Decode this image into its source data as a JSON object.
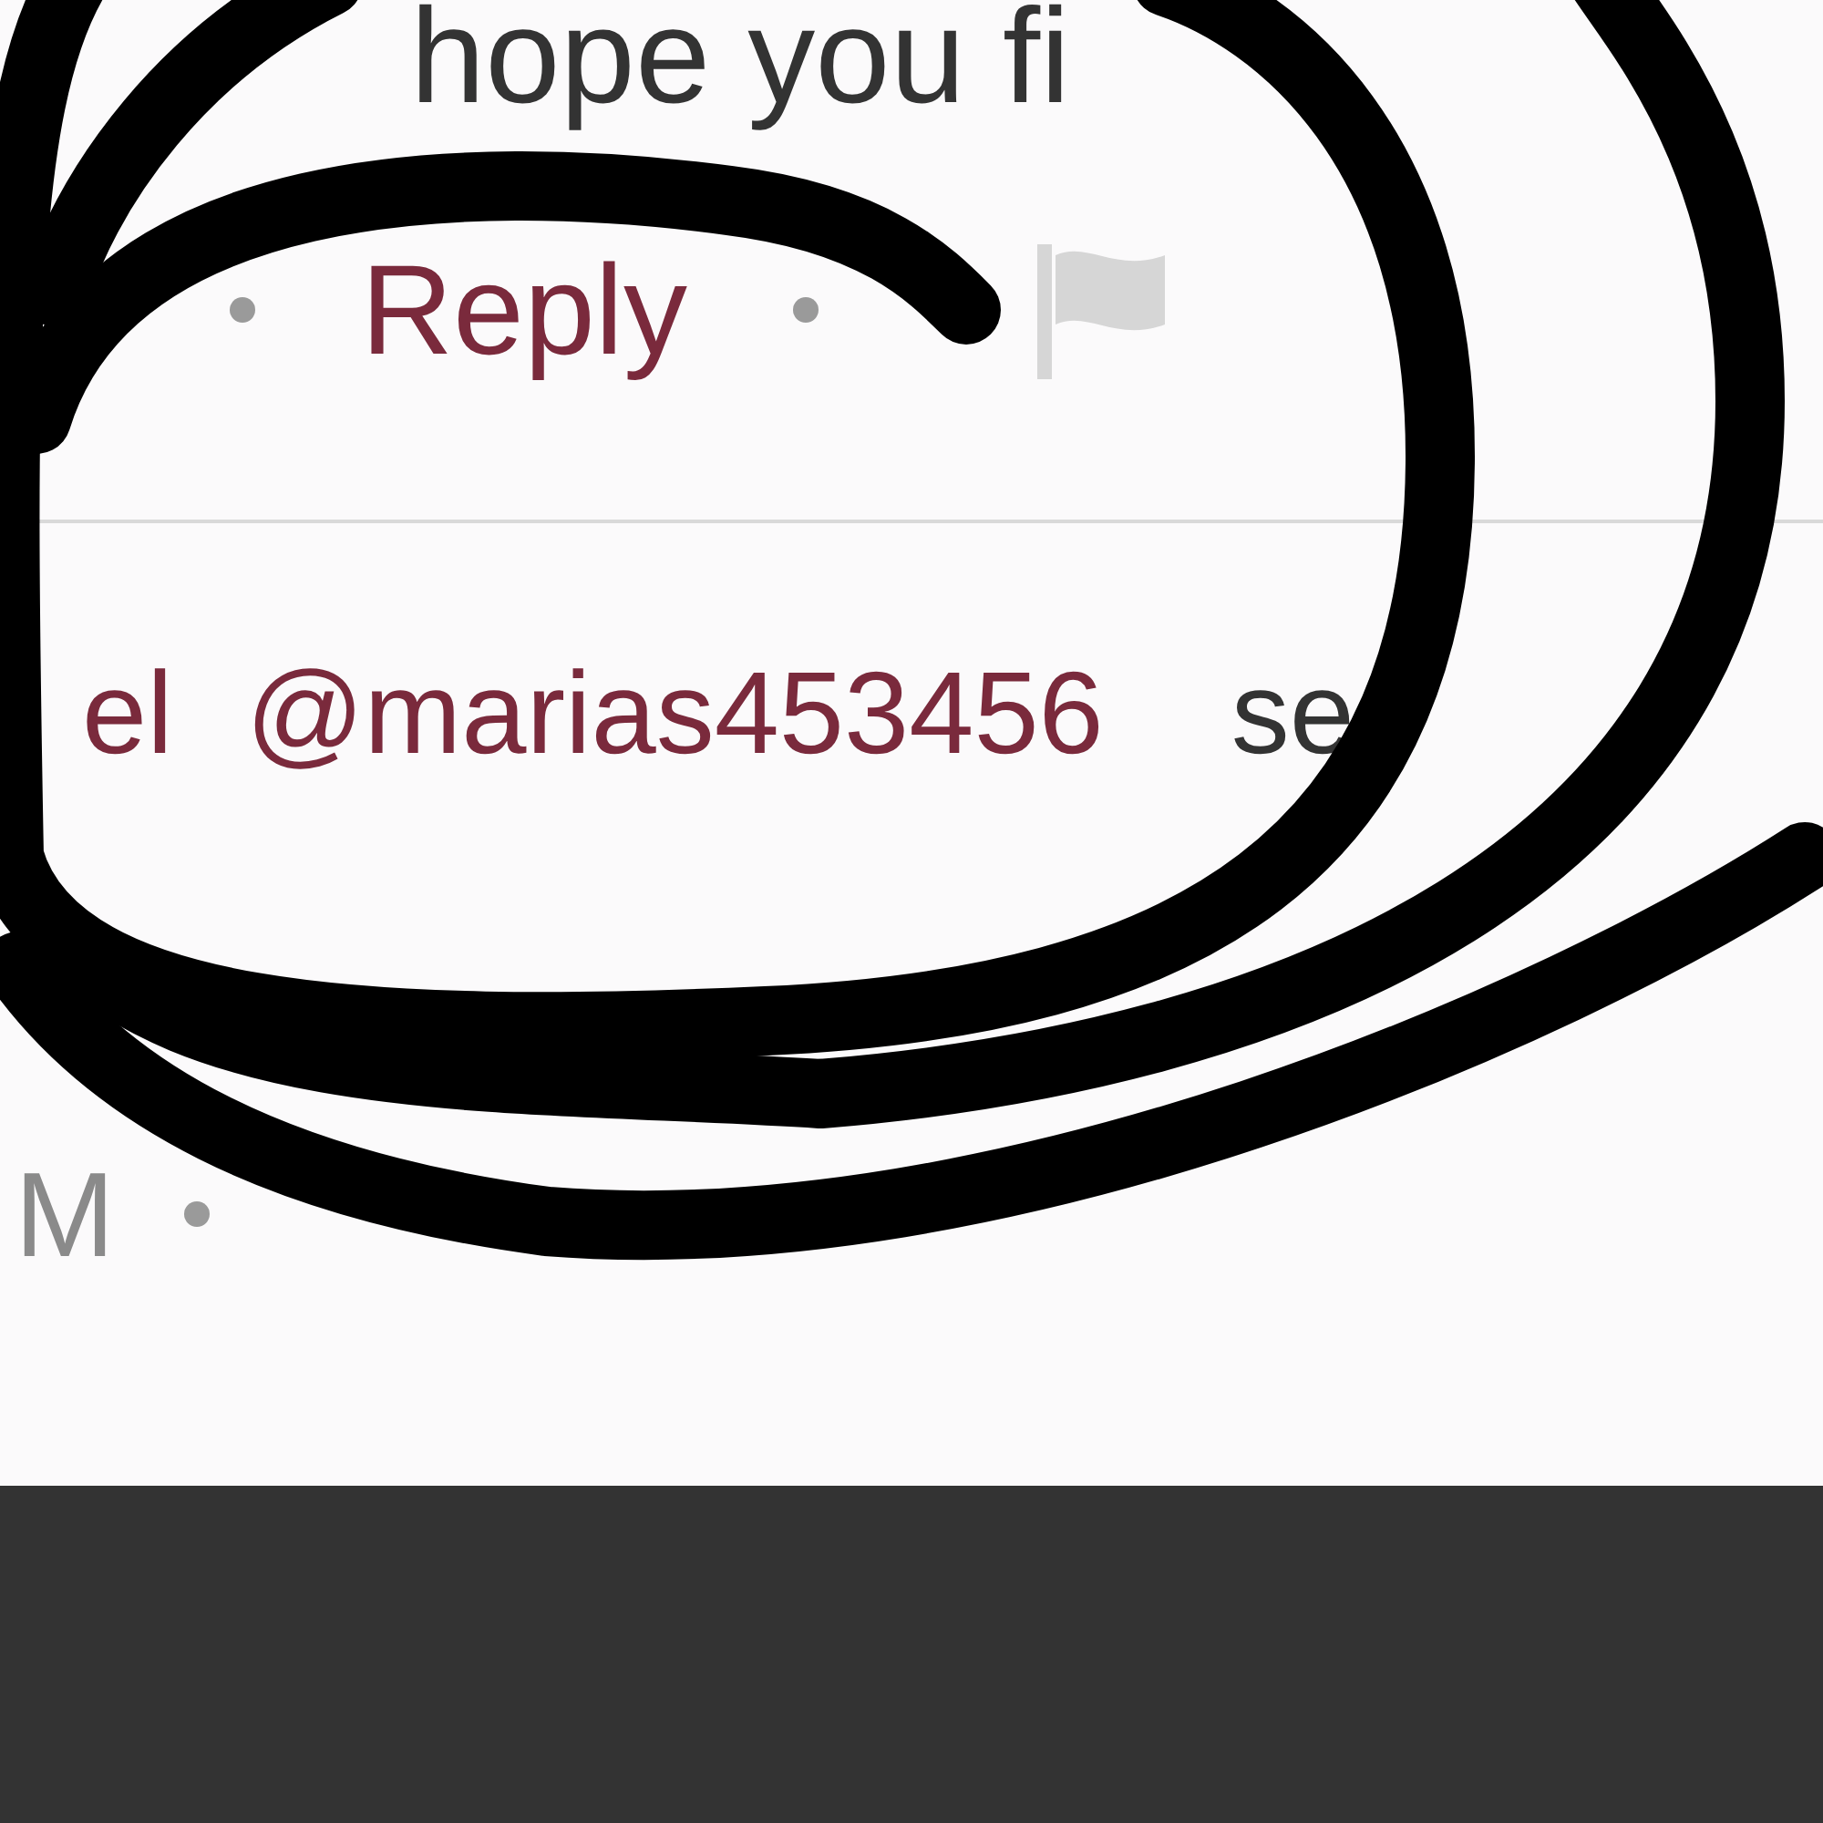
{
  "comment_text": "hope you fi",
  "actions": [
    {
      "kind": "dot"
    },
    {
      "kind": "reply",
      "label": "Reply"
    },
    {
      "kind": "dot"
    },
    {
      "kind": "flag"
    }
  ],
  "reply": {
    "name": "el",
    "mention": "@marias453456",
    "text": "se"
  },
  "reply_actions": [
    {
      "kind": "time",
      "label": "M"
    },
    {
      "kind": "dot"
    }
  ]
}
